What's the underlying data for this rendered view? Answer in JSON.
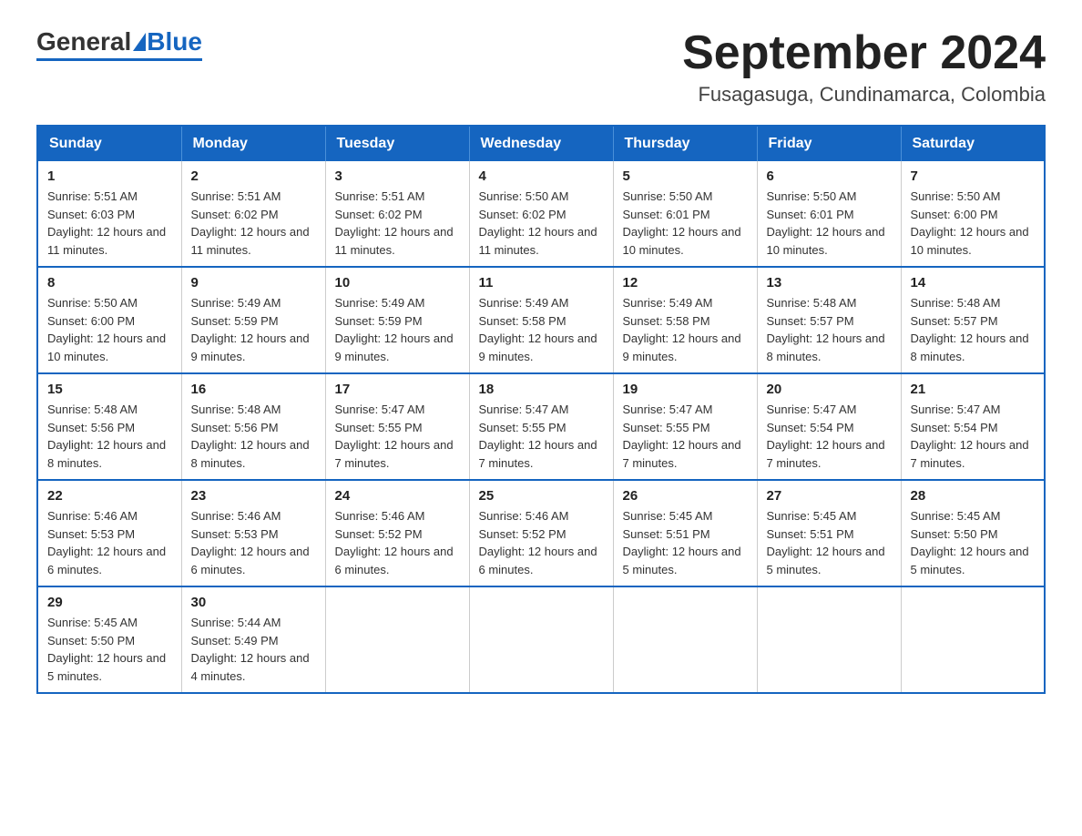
{
  "logo": {
    "general": "General",
    "blue": "Blue"
  },
  "header": {
    "title": "September 2024",
    "subtitle": "Fusagasuga, Cundinamarca, Colombia"
  },
  "days": [
    "Sunday",
    "Monday",
    "Tuesday",
    "Wednesday",
    "Thursday",
    "Friday",
    "Saturday"
  ],
  "weeks": [
    [
      {
        "day": "1",
        "sunrise": "5:51 AM",
        "sunset": "6:03 PM",
        "daylight": "12 hours and 11 minutes."
      },
      {
        "day": "2",
        "sunrise": "5:51 AM",
        "sunset": "6:02 PM",
        "daylight": "12 hours and 11 minutes."
      },
      {
        "day": "3",
        "sunrise": "5:51 AM",
        "sunset": "6:02 PM",
        "daylight": "12 hours and 11 minutes."
      },
      {
        "day": "4",
        "sunrise": "5:50 AM",
        "sunset": "6:02 PM",
        "daylight": "12 hours and 11 minutes."
      },
      {
        "day": "5",
        "sunrise": "5:50 AM",
        "sunset": "6:01 PM",
        "daylight": "12 hours and 10 minutes."
      },
      {
        "day": "6",
        "sunrise": "5:50 AM",
        "sunset": "6:01 PM",
        "daylight": "12 hours and 10 minutes."
      },
      {
        "day": "7",
        "sunrise": "5:50 AM",
        "sunset": "6:00 PM",
        "daylight": "12 hours and 10 minutes."
      }
    ],
    [
      {
        "day": "8",
        "sunrise": "5:50 AM",
        "sunset": "6:00 PM",
        "daylight": "12 hours and 10 minutes."
      },
      {
        "day": "9",
        "sunrise": "5:49 AM",
        "sunset": "5:59 PM",
        "daylight": "12 hours and 9 minutes."
      },
      {
        "day": "10",
        "sunrise": "5:49 AM",
        "sunset": "5:59 PM",
        "daylight": "12 hours and 9 minutes."
      },
      {
        "day": "11",
        "sunrise": "5:49 AM",
        "sunset": "5:58 PM",
        "daylight": "12 hours and 9 minutes."
      },
      {
        "day": "12",
        "sunrise": "5:49 AM",
        "sunset": "5:58 PM",
        "daylight": "12 hours and 9 minutes."
      },
      {
        "day": "13",
        "sunrise": "5:48 AM",
        "sunset": "5:57 PM",
        "daylight": "12 hours and 8 minutes."
      },
      {
        "day": "14",
        "sunrise": "5:48 AM",
        "sunset": "5:57 PM",
        "daylight": "12 hours and 8 minutes."
      }
    ],
    [
      {
        "day": "15",
        "sunrise": "5:48 AM",
        "sunset": "5:56 PM",
        "daylight": "12 hours and 8 minutes."
      },
      {
        "day": "16",
        "sunrise": "5:48 AM",
        "sunset": "5:56 PM",
        "daylight": "12 hours and 8 minutes."
      },
      {
        "day": "17",
        "sunrise": "5:47 AM",
        "sunset": "5:55 PM",
        "daylight": "12 hours and 7 minutes."
      },
      {
        "day": "18",
        "sunrise": "5:47 AM",
        "sunset": "5:55 PM",
        "daylight": "12 hours and 7 minutes."
      },
      {
        "day": "19",
        "sunrise": "5:47 AM",
        "sunset": "5:55 PM",
        "daylight": "12 hours and 7 minutes."
      },
      {
        "day": "20",
        "sunrise": "5:47 AM",
        "sunset": "5:54 PM",
        "daylight": "12 hours and 7 minutes."
      },
      {
        "day": "21",
        "sunrise": "5:47 AM",
        "sunset": "5:54 PM",
        "daylight": "12 hours and 7 minutes."
      }
    ],
    [
      {
        "day": "22",
        "sunrise": "5:46 AM",
        "sunset": "5:53 PM",
        "daylight": "12 hours and 6 minutes."
      },
      {
        "day": "23",
        "sunrise": "5:46 AM",
        "sunset": "5:53 PM",
        "daylight": "12 hours and 6 minutes."
      },
      {
        "day": "24",
        "sunrise": "5:46 AM",
        "sunset": "5:52 PM",
        "daylight": "12 hours and 6 minutes."
      },
      {
        "day": "25",
        "sunrise": "5:46 AM",
        "sunset": "5:52 PM",
        "daylight": "12 hours and 6 minutes."
      },
      {
        "day": "26",
        "sunrise": "5:45 AM",
        "sunset": "5:51 PM",
        "daylight": "12 hours and 5 minutes."
      },
      {
        "day": "27",
        "sunrise": "5:45 AM",
        "sunset": "5:51 PM",
        "daylight": "12 hours and 5 minutes."
      },
      {
        "day": "28",
        "sunrise": "5:45 AM",
        "sunset": "5:50 PM",
        "daylight": "12 hours and 5 minutes."
      }
    ],
    [
      {
        "day": "29",
        "sunrise": "5:45 AM",
        "sunset": "5:50 PM",
        "daylight": "12 hours and 5 minutes."
      },
      {
        "day": "30",
        "sunrise": "5:44 AM",
        "sunset": "5:49 PM",
        "daylight": "12 hours and 4 minutes."
      },
      null,
      null,
      null,
      null,
      null
    ]
  ]
}
